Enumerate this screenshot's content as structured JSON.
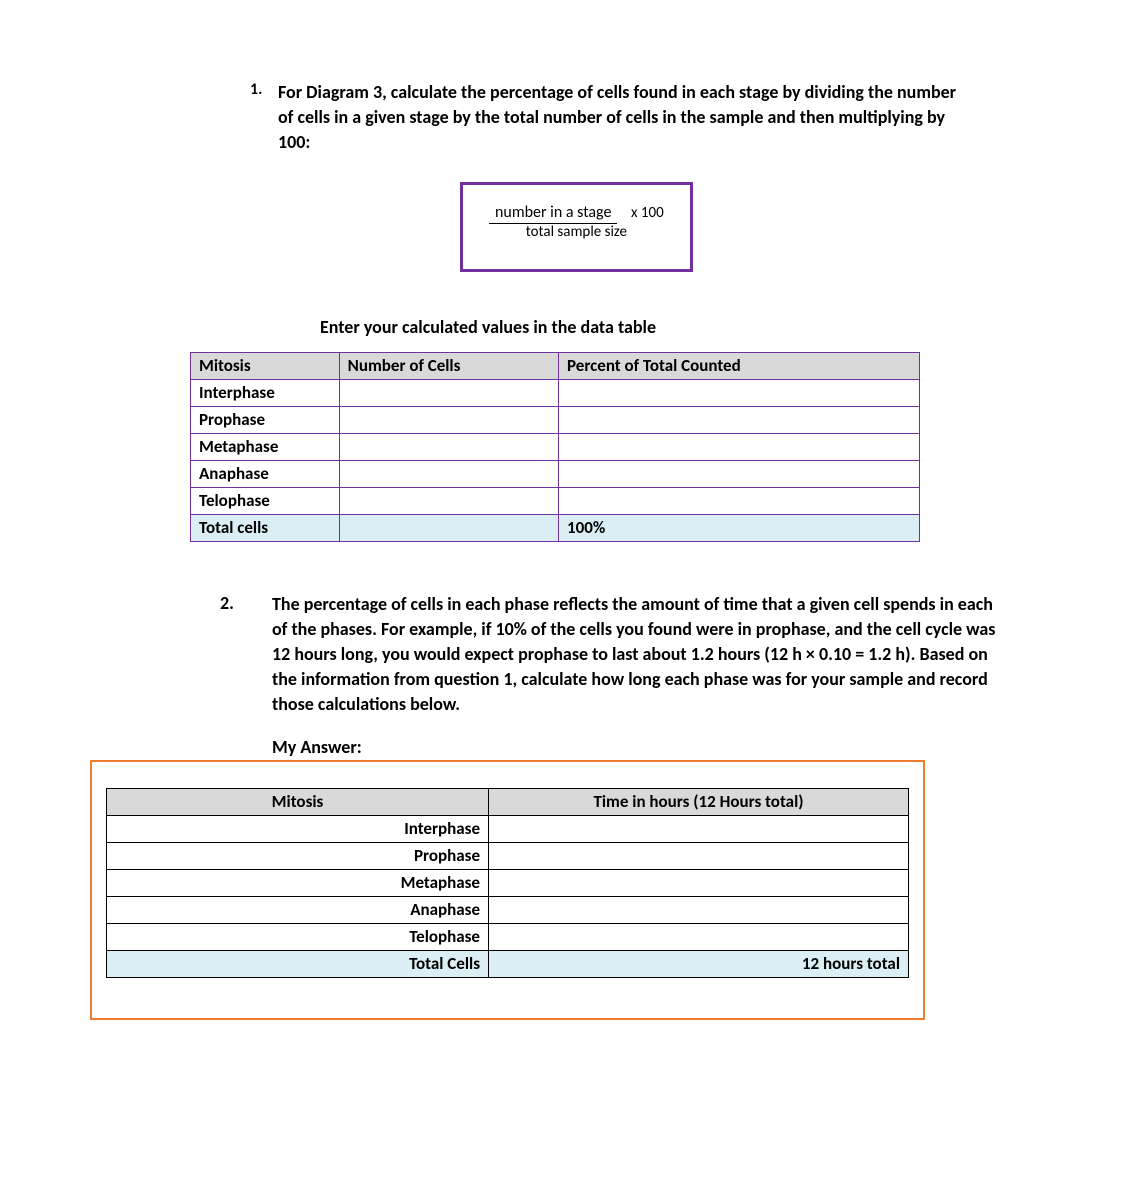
{
  "q1": {
    "number": "1.",
    "text": "For Diagram 3, calculate the percentage of cells found in each stage by dividing the number of cells in a given stage by the total number of cells in the sample and then multiplying by 100:"
  },
  "formula": {
    "numerator": "number in a stage",
    "mult": "x 100",
    "denominator": "total sample size"
  },
  "enter_line": "Enter your calculated values in the data table",
  "table1": {
    "headers": [
      "Mitosis",
      "Number of Cells",
      "Percent of Total Counted"
    ],
    "rows": [
      {
        "stage": "Interphase",
        "num": "",
        "pct": ""
      },
      {
        "stage": "Prophase",
        "num": "",
        "pct": ""
      },
      {
        "stage": "Metaphase",
        "num": "",
        "pct": ""
      },
      {
        "stage": "Anaphase",
        "num": "",
        "pct": ""
      },
      {
        "stage": "Telophase",
        "num": "",
        "pct": ""
      }
    ],
    "total_label": "Total cells",
    "total_num": "",
    "total_pct": "100%"
  },
  "q2": {
    "number": "2.",
    "text": "The percentage of cells in each phase reflects the amount of time that a given cell spends in each of the phases. For example, if 10% of the cells you found were in prophase, and the cell cycle was 12 hours long, you would expect prophase to last about 1.2 hours (12 h × 0.10 = 1.2 h). Based on the information from question 1, calculate how long each phase was for your sample and record those calculations below."
  },
  "my_answer_label": "My Answer:",
  "table2": {
    "headers": [
      "Mitosis",
      "Time in hours (12 Hours total)"
    ],
    "rows": [
      {
        "stage": "Interphase",
        "time": ""
      },
      {
        "stage": "Prophase",
        "time": ""
      },
      {
        "stage": "Metaphase",
        "time": ""
      },
      {
        "stage": "Anaphase",
        "time": ""
      },
      {
        "stage": "Telophase",
        "time": ""
      }
    ],
    "total_label": "Total Cells",
    "total_time": "12 hours total"
  }
}
